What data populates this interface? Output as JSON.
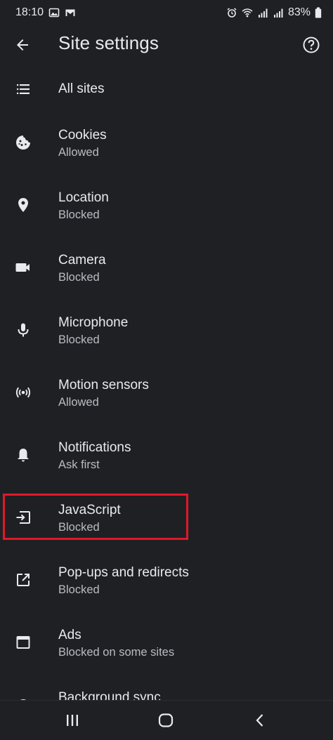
{
  "status_bar": {
    "time": "18:10",
    "battery": "83%"
  },
  "app_bar": {
    "title": "Site settings"
  },
  "items": [
    {
      "title": "All sites",
      "subtitle": "",
      "icon": "list-icon"
    },
    {
      "title": "Cookies",
      "subtitle": "Allowed",
      "icon": "cookie-icon"
    },
    {
      "title": "Location",
      "subtitle": "Blocked",
      "icon": "location-icon"
    },
    {
      "title": "Camera",
      "subtitle": "Blocked",
      "icon": "camera-icon"
    },
    {
      "title": "Microphone",
      "subtitle": "Blocked",
      "icon": "microphone-icon"
    },
    {
      "title": "Motion sensors",
      "subtitle": "Allowed",
      "icon": "motion-sensors-icon"
    },
    {
      "title": "Notifications",
      "subtitle": "Ask first",
      "icon": "bell-icon"
    },
    {
      "title": "JavaScript",
      "subtitle": "Blocked",
      "icon": "javascript-icon"
    },
    {
      "title": "Pop-ups and redirects",
      "subtitle": "Blocked",
      "icon": "popup-icon"
    },
    {
      "title": "Ads",
      "subtitle": "Blocked on some sites",
      "icon": "ads-icon"
    },
    {
      "title": "Background sync",
      "subtitle": "",
      "icon": "sync-icon"
    }
  ],
  "colors": {
    "background": "#1f2023",
    "text_primary": "#e8eaed",
    "text_secondary": "#b8bcc2",
    "highlight": "#e0182a"
  }
}
